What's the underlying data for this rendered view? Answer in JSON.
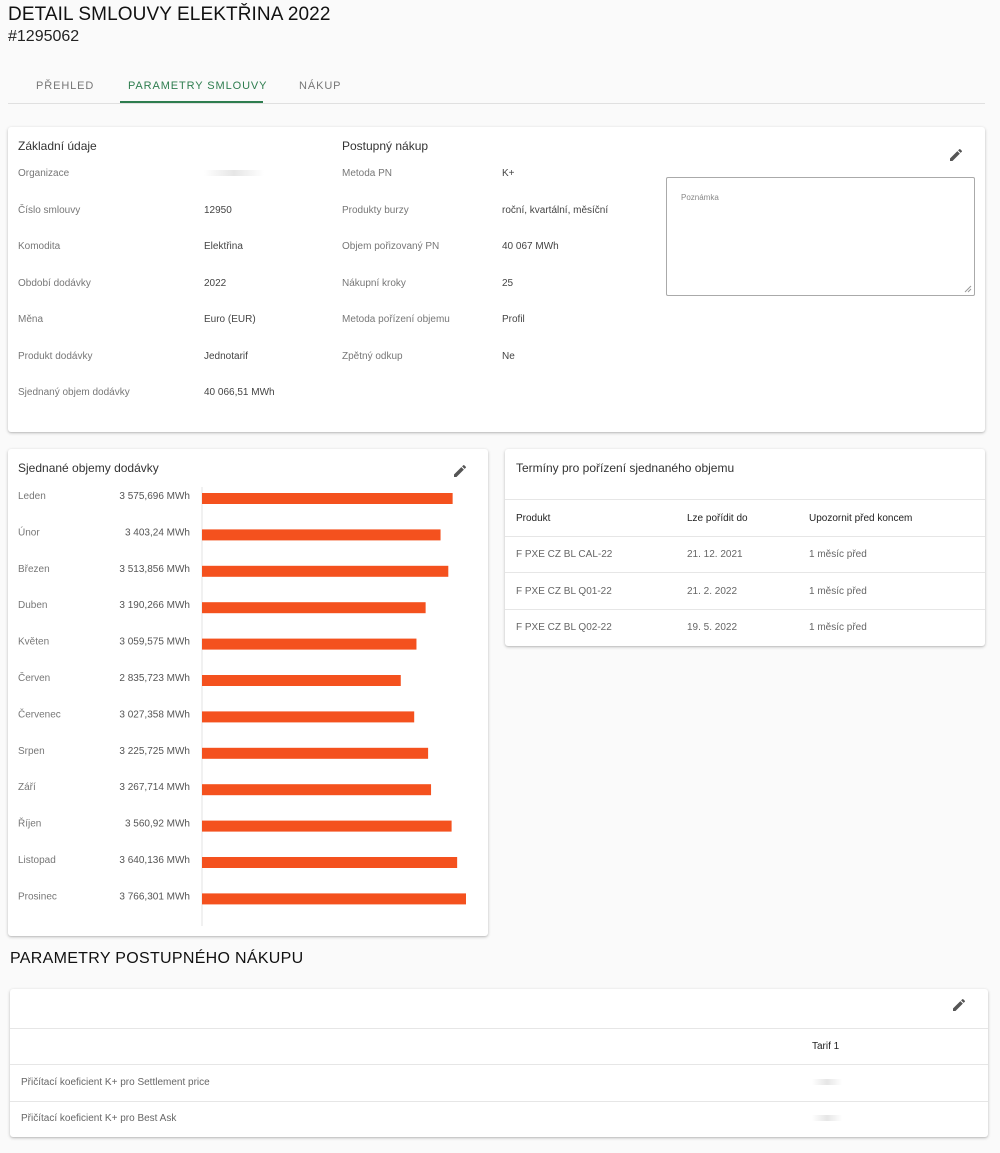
{
  "header": {
    "title": "DETAIL SMLOUVY ELEKTŘINA 2022",
    "contract_id": "#1295062"
  },
  "tabs": [
    {
      "label": "PŘEHLED"
    },
    {
      "label": "PARAMETRY SMLOUVY"
    },
    {
      "label": "NÁKUP"
    }
  ],
  "basic": {
    "title": "Základní údaje",
    "rows": [
      {
        "label": "Organizace",
        "value": ""
      },
      {
        "label": "Číslo smlouvy",
        "value": "12950"
      },
      {
        "label": "Komodita",
        "value": "Elektřina"
      },
      {
        "label": "Období dodávky",
        "value": "2022"
      },
      {
        "label": "Měna",
        "value": "Euro (EUR)"
      },
      {
        "label": "Produkt dodávky",
        "value": "Jednotarif"
      },
      {
        "label": "Sjednaný objem dodávky",
        "value": "40 066,51 MWh"
      }
    ]
  },
  "gradual": {
    "title": "Postupný nákup",
    "rows": [
      {
        "label": "Metoda PN",
        "value": "K+"
      },
      {
        "label": "Produkty burzy",
        "value": "roční, kvartální, měsíční"
      },
      {
        "label": "Objem pořizovaný PN",
        "value": "40 067 MWh"
      },
      {
        "label": "Nákupní kroky",
        "value": "25"
      },
      {
        "label": "Metoda pořízení objemu",
        "value": "Profil"
      },
      {
        "label": "Zpětný odkup",
        "value": "Ne"
      }
    ]
  },
  "note": {
    "label": "Poznámka"
  },
  "volumes": {
    "title": "Sjednané objemy dodávky"
  },
  "chart_data": {
    "type": "bar",
    "orientation": "horizontal",
    "title": "Sjednané objemy dodávky",
    "categories": [
      "Leden",
      "Únor",
      "Březen",
      "Duben",
      "Květen",
      "Červen",
      "Červenec",
      "Srpen",
      "Září",
      "Říjen",
      "Listopad",
      "Prosinec"
    ],
    "value_labels": [
      "3 575,696 MWh",
      "3 403,24 MWh",
      "3 513,856 MWh",
      "3 190,266 MWh",
      "3 059,575 MWh",
      "2 835,723 MWh",
      "3 027,358 MWh",
      "3 225,725 MWh",
      "3 267,714 MWh",
      "3 560,92 MWh",
      "3 640,136 MWh",
      "3 766,301 MWh"
    ],
    "values": [
      3575.696,
      3403.24,
      3513.856,
      3190.266,
      3059.575,
      2835.723,
      3027.358,
      3225.725,
      3267.714,
      3560.92,
      3640.136,
      3766.301
    ],
    "xlim": [
      0,
      3766.301
    ],
    "bar_color": "#f4511e"
  },
  "terms": {
    "title": "Termíny pro pořízení sjednaného objemu",
    "columns": [
      "Produkt",
      "Lze pořídit do",
      "Upozornit před koncem"
    ],
    "rows": [
      [
        "F PXE CZ BL CAL-22",
        "21. 12. 2021",
        "1 měsíc před"
      ],
      [
        "F PXE CZ BL Q01-22",
        "21. 2. 2022",
        "1 měsíc před"
      ],
      [
        "F PXE CZ BL Q02-22",
        "19. 5. 2022",
        "1 měsíc před"
      ]
    ]
  },
  "params": {
    "title": "PARAMETRY POSTUPNÉHO NÁKUPU",
    "column": "Tarif 1",
    "rows": [
      {
        "label": "Přičítací koeficient K+ pro Settlement price"
      },
      {
        "label": "Přičítací koeficient K+ pro Best Ask"
      }
    ]
  },
  "colors": {
    "accent": "#2e7d4f",
    "bar": "#f4511e"
  },
  "icons": {
    "edit": "pencil-icon"
  }
}
